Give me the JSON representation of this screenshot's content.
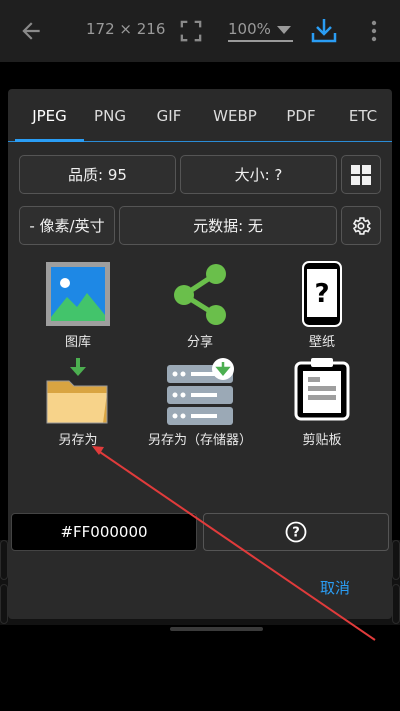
{
  "appbar": {
    "dimensions": "172 × 216",
    "zoom": "100%"
  },
  "tabs": [
    {
      "label": "JPEG",
      "active": true
    },
    {
      "label": "PNG",
      "active": false
    },
    {
      "label": "GIF",
      "active": false
    },
    {
      "label": "WEBP",
      "active": false
    },
    {
      "label": "PDF",
      "active": false
    },
    {
      "label": "ETC",
      "active": false
    }
  ],
  "options": {
    "quality_label": "品质: 95",
    "size_label": "大小: ?",
    "unit_label": "- 像素/英寸",
    "metadata_label": "元数据: 无"
  },
  "actions": {
    "gallery": "图库",
    "share": "分享",
    "wallpaper": "壁纸",
    "save_as": "另存为",
    "save_as_storage": "另存为（存储器）",
    "clipboard": "剪贴板"
  },
  "color": {
    "value": "#FF000000"
  },
  "dialog": {
    "cancel_label": "取消"
  },
  "colors": {
    "accent": "#2a9df4",
    "share_green": "#6abf4b",
    "annotation_red": "#e03b3b"
  },
  "icons": [
    "back-arrow-icon",
    "fit-screen-icon",
    "download-icon",
    "more-vert-icon",
    "grid-icon",
    "gear-icon",
    "gallery-image-icon",
    "share-icon",
    "wallpaper-phone-icon",
    "folder-download-icon",
    "storage-download-icon",
    "clipboard-icon",
    "help-icon"
  ]
}
